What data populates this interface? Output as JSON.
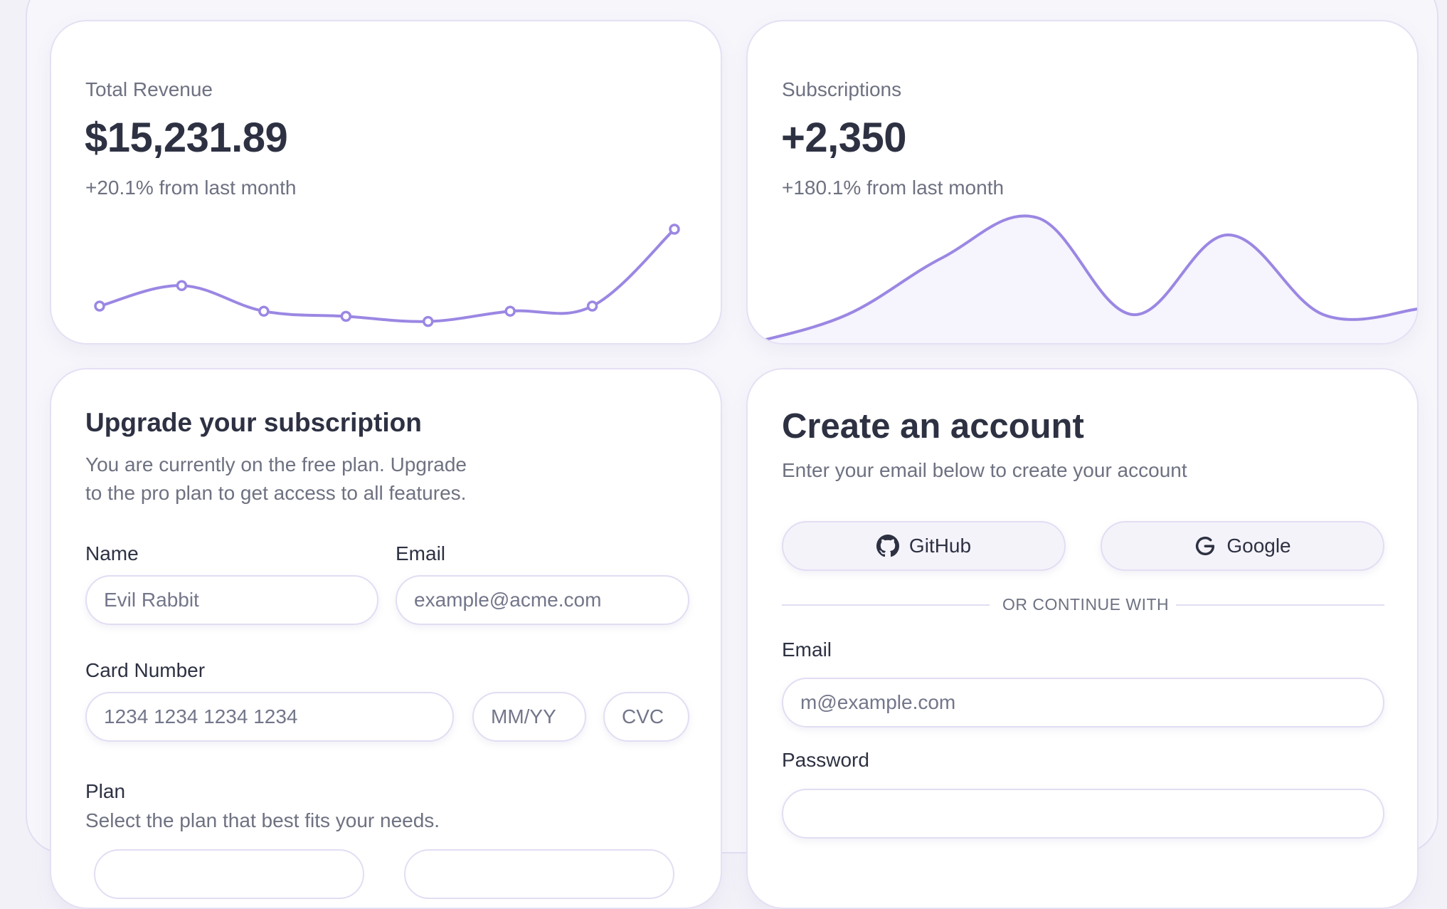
{
  "revenue": {
    "label": "Total Revenue",
    "value": "$15,231.89",
    "delta": "+20.1% from last month"
  },
  "subscriptions": {
    "label": "Subscriptions",
    "value": "+2,350",
    "delta": "+180.1% from last month"
  },
  "upgrade": {
    "title": "Upgrade your subscription",
    "description_line1": "You are currently on the free plan. Upgrade",
    "description_line2": "to the pro plan to get access to all features.",
    "name_label": "Name",
    "name_value": "Evil Rabbit",
    "email_label": "Email",
    "email_placeholder": "example@acme.com",
    "card_label": "Card Number",
    "card_placeholder": "1234 1234 1234 1234",
    "expiry_placeholder": "MM/YY",
    "cvc_placeholder": "CVC",
    "plan_label": "Plan",
    "plan_description": "Select the plan that best fits your needs."
  },
  "account": {
    "title": "Create an account",
    "subtitle": "Enter your email below to create your account",
    "github_label": "GitHub",
    "google_label": "Google",
    "divider": "OR CONTINUE WITH",
    "email_label": "Email",
    "email_placeholder": "m@example.com",
    "password_label": "Password"
  },
  "colors": {
    "accent": "#9b87e3",
    "card_border": "#e5e0f4",
    "background": "#f3f1f8"
  },
  "chart_data": [
    {
      "type": "line",
      "x": [
        1,
        2,
        3,
        4,
        5,
        6,
        7,
        8
      ],
      "values": [
        10,
        14,
        9,
        8,
        7,
        9,
        10,
        25
      ],
      "markers": true,
      "grid": false
    },
    {
      "type": "area",
      "x": [
        1,
        2,
        3,
        4,
        5,
        6,
        7,
        8
      ],
      "values": [
        2,
        7,
        17,
        24,
        7,
        21,
        7,
        8
      ],
      "markers": false,
      "grid": false
    }
  ]
}
